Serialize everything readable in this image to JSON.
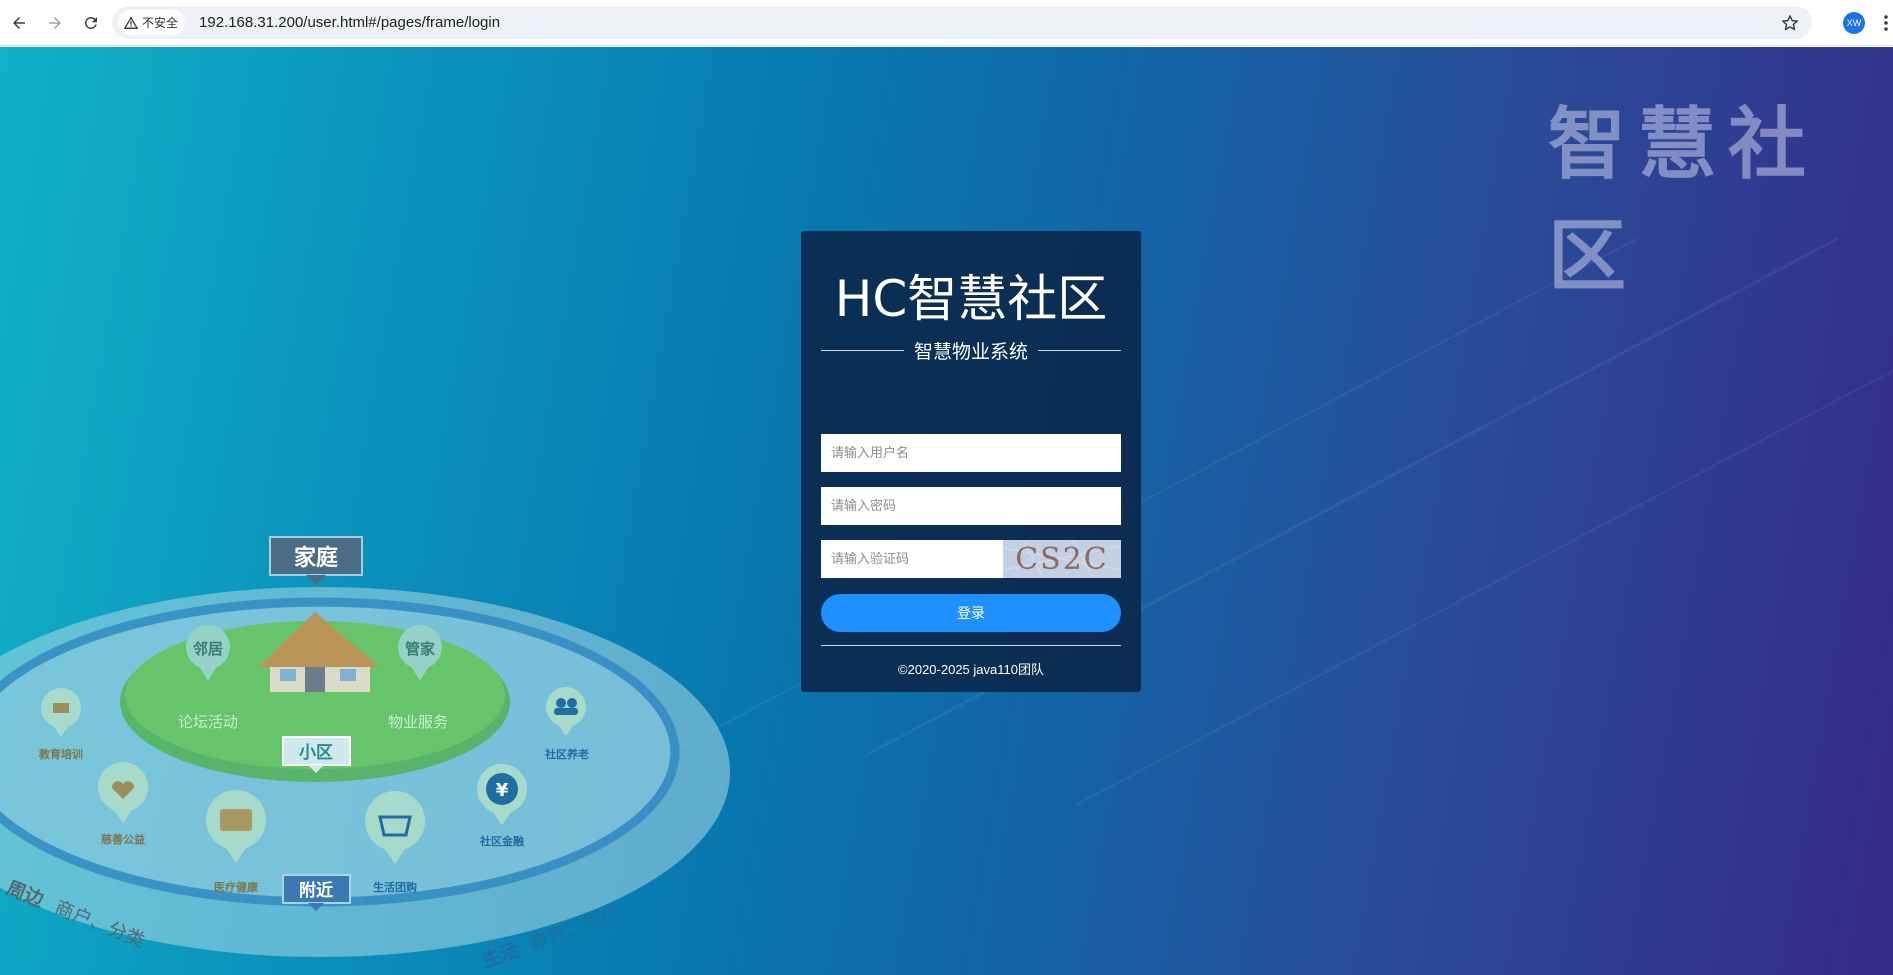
{
  "browser": {
    "security_label": "不安全",
    "url": "192.168.31.200/user.html#/pages/frame/login",
    "profile_initials": "XW"
  },
  "page": {
    "brand_mark": "智慧社区"
  },
  "illustration": {
    "center_tag": "家庭",
    "middle_tag": "小区",
    "outer_tag": "附近",
    "inner_left_icon_label": "邻居",
    "inner_left_caption": "论坛活动",
    "inner_right_icon_label": "管家",
    "inner_right_caption": "物业服务",
    "services": [
      "教育培训",
      "慈善公益",
      "医疗健康",
      "生活团购",
      "社区金融",
      "社区养老"
    ],
    "ring_text_left_bold": "周边",
    "ring_text_left": "商户、分类",
    "ring_text_right_bold": "生活",
    "ring_text_right": "教育、医疗"
  },
  "login": {
    "title": "HC智慧社区",
    "subtitle": "智慧物业系统",
    "username_placeholder": "请输入用户名",
    "password_placeholder": "请输入密码",
    "captcha_placeholder": "请输入验证码",
    "captcha_text": "CS2C",
    "submit_label": "登录",
    "copyright": "©2020-2025 java110团队"
  }
}
